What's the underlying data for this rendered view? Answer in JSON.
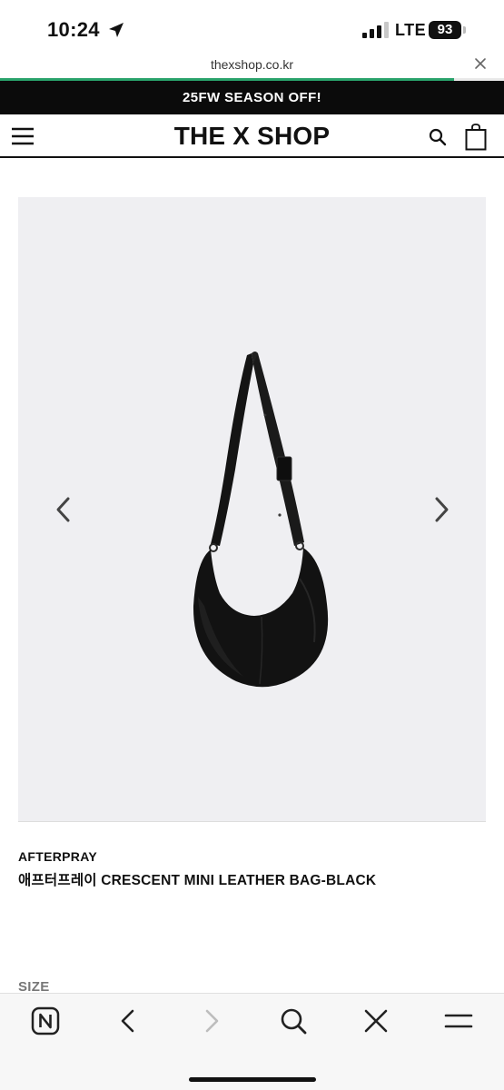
{
  "status_bar": {
    "time": "10:24",
    "network": "LTE",
    "battery": "93"
  },
  "browser": {
    "url": "thexshop.co.kr",
    "load_progress": 0.9
  },
  "promo": {
    "text": "25FW SEASON OFF!"
  },
  "header": {
    "logo": "THE X SHOP"
  },
  "product": {
    "brand": "AFTERPRAY",
    "name": "애프터프레이 CRESCENT MINI LEATHER BAG-BLACK",
    "size_label": "SIZE"
  },
  "icons": {
    "status": [
      "location-arrow-icon",
      "signal-icon"
    ],
    "header": [
      "hamburger-menu-icon",
      "search-icon",
      "shopping-bag-icon"
    ],
    "toolbar": [
      "naver-home-icon",
      "back-icon",
      "forward-icon",
      "search-icon",
      "close-icon",
      "menu-icon"
    ]
  },
  "colors": {
    "progress": "#2aa36b",
    "promo_bg": "#0b0b0b",
    "image_bg": "#efeff2"
  }
}
